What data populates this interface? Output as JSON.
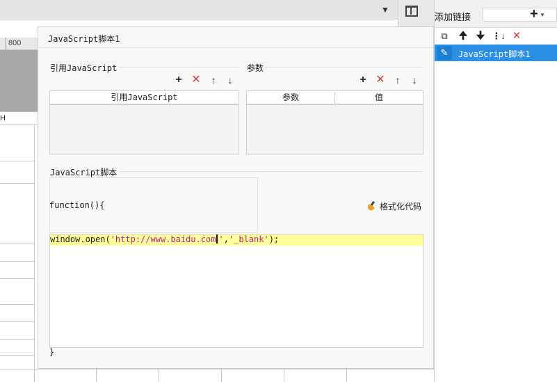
{
  "background": {
    "ruler_label": "800",
    "column_header": "H"
  },
  "right_panel": {
    "title": "添加链接",
    "add_icon": "plus-icon",
    "tools": [
      "copy-icon",
      "arrow-up-icon",
      "arrow-down-icon",
      "move-bottom-icon",
      "delete-icon"
    ],
    "items": [
      {
        "label": "JavaScript脚本1",
        "icon": "pencil-icon",
        "selected": true
      }
    ]
  },
  "dialog": {
    "title": "JavaScript脚本1",
    "ref_section": {
      "label": "引用JavaScript",
      "column_header": "引用JavaScript",
      "rows": []
    },
    "params_section": {
      "label": "参数",
      "columns": [
        "参数",
        "值"
      ],
      "rows": []
    },
    "script_section": {
      "label": "JavaScript脚本",
      "function_header": "function(){",
      "format_button": "格式化代码",
      "code_line": {
        "prefix": "window.open(",
        "url_string": "'http://www.baidu.com",
        "url_string_end": "'",
        "separator": ",",
        "target_string": "'_blank'",
        "suffix": ");"
      },
      "function_close": "}"
    },
    "accent_colors": {
      "delete": "#e23a3a",
      "selection": "#2c8fe6",
      "highlight_line": "#ffff99",
      "string": "#c21d8d"
    }
  }
}
